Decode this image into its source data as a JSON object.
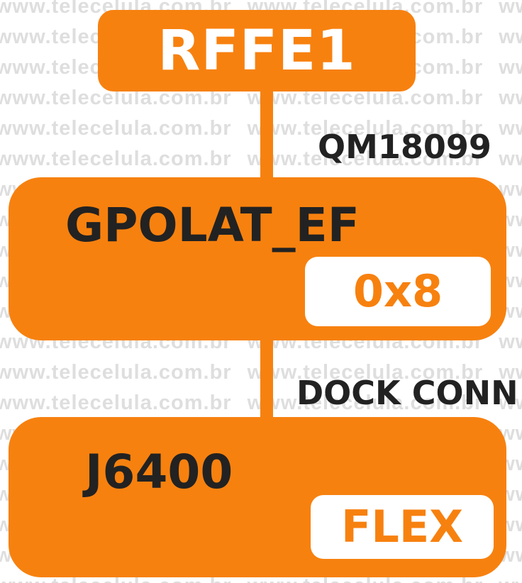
{
  "watermark": {
    "text": "www.telecelula.com.br"
  },
  "diagram": {
    "nodes": [
      {
        "id": "rffe",
        "title": "RFFE1"
      },
      {
        "id": "gpo",
        "title": "GPOLAT_EF",
        "tag": "0x8"
      },
      {
        "id": "j6400",
        "title": "J6400",
        "tag": "FLEX"
      }
    ],
    "edges": [
      {
        "from": "rffe",
        "to": "gpo",
        "label": "QM18099"
      },
      {
        "from": "gpo",
        "to": "j6400",
        "label": "DOCK CONN"
      }
    ]
  },
  "colors": {
    "accent": "#f7810f",
    "text_dark": "#222222",
    "watermark": "#dedede"
  }
}
